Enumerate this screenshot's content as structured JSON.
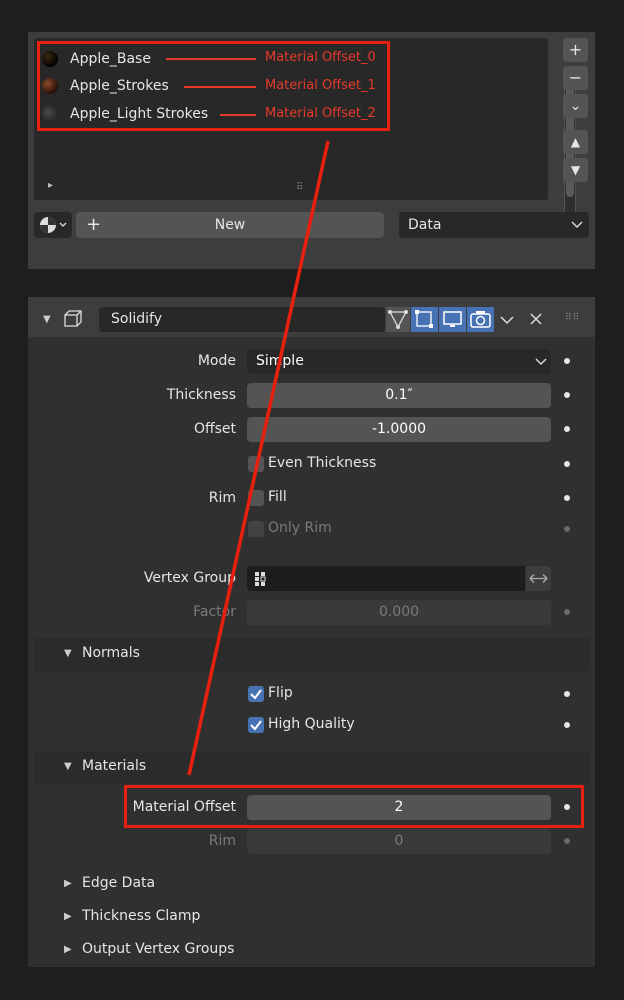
{
  "materials": {
    "slots": [
      {
        "name": "Apple_Base",
        "offset_label": "Material Offset_0",
        "swatch": "#1a1208"
      },
      {
        "name": "Apple_Strokes",
        "offset_label": "Material Offset_1",
        "swatch": "#5a2a18"
      },
      {
        "name": "Apple_Light Strokes",
        "offset_label": "Material Offset_2",
        "swatch": "#3a3a3a"
      }
    ],
    "side_buttons": {
      "add": "+",
      "remove": "−",
      "specials": "⌄",
      "up": "▲",
      "down": "▼"
    },
    "new_label": "New",
    "new_plus": "+",
    "link_value": "Data",
    "expand_glyph": "▸",
    "grip_glyph": "⠿"
  },
  "modifier": {
    "name": "Solidify",
    "mode_label": "Mode",
    "mode_value": "Simple",
    "thickness_label": "Thickness",
    "thickness_value": "0.1″",
    "offset_label": "Offset",
    "offset_value": "-1.0000",
    "even_thickness_label": "Even Thickness",
    "rim_label": "Rim",
    "fill_label": "Fill",
    "only_rim_label": "Only Rim",
    "vertex_group_label": "Vertex Group",
    "factor_label": "Factor",
    "factor_value": "0.000",
    "normals": {
      "title": "Normals",
      "flip_label": "Flip",
      "flip_checked": true,
      "high_quality_label": "High Quality",
      "high_quality_checked": true
    },
    "materials": {
      "title": "Materials",
      "material_offset_label": "Material Offset",
      "material_offset_value": "2",
      "rim_label": "Rim",
      "rim_value": "0"
    },
    "collapsed_sections": [
      "Edge Data",
      "Thickness Clamp",
      "Output Vertex Groups"
    ]
  },
  "colors": {
    "annotation_red": "#e8200f",
    "accent_blue": "#4772b3"
  }
}
